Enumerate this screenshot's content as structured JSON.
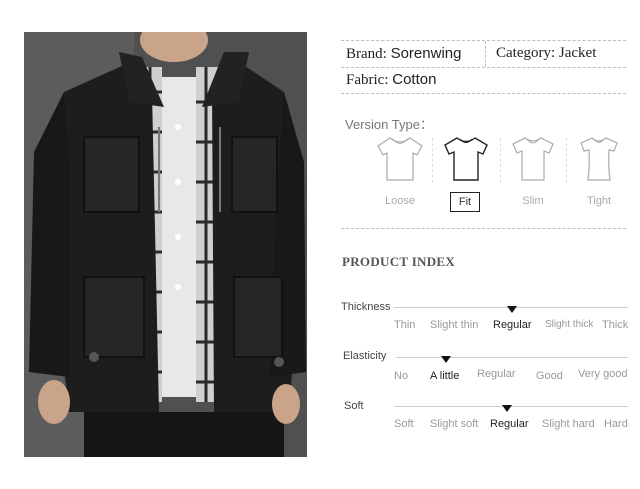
{
  "specs": {
    "brand_label": "Brand:",
    "brand_value": "Sorenwing",
    "category_label": "Category:",
    "category_value": "Jacket",
    "fabric_label": "Fabric:",
    "fabric_value": "Cotton"
  },
  "version": {
    "title": "Version Type：",
    "options": [
      "Loose",
      "Fit",
      "Slim",
      "Tight"
    ],
    "selected": "Fit"
  },
  "product_index": {
    "title": "PRODUCT INDEX",
    "rows": [
      {
        "label": "Thickness",
        "options": [
          "Thin",
          "Slight thin",
          "Regular",
          "Slight thick",
          "Thick"
        ],
        "selected": "Regular"
      },
      {
        "label": "Elasticity",
        "options": [
          "No",
          "A little",
          "Regular",
          "Good",
          "Very good"
        ],
        "selected": "A little"
      },
      {
        "label": "Soft",
        "options": [
          "Soft",
          "Slight soft",
          "Regular",
          "Slight hard",
          "Hard"
        ],
        "selected": "Regular"
      }
    ]
  },
  "colors": {
    "jacket": "#1c1c1c",
    "shirt_plaid": "#d9d9d9",
    "marker": "#111111"
  },
  "icons": [
    "tshirt-loose-icon",
    "tshirt-fit-icon",
    "tshirt-slim-icon",
    "tshirt-tight-icon",
    "index-marker-icon"
  ]
}
